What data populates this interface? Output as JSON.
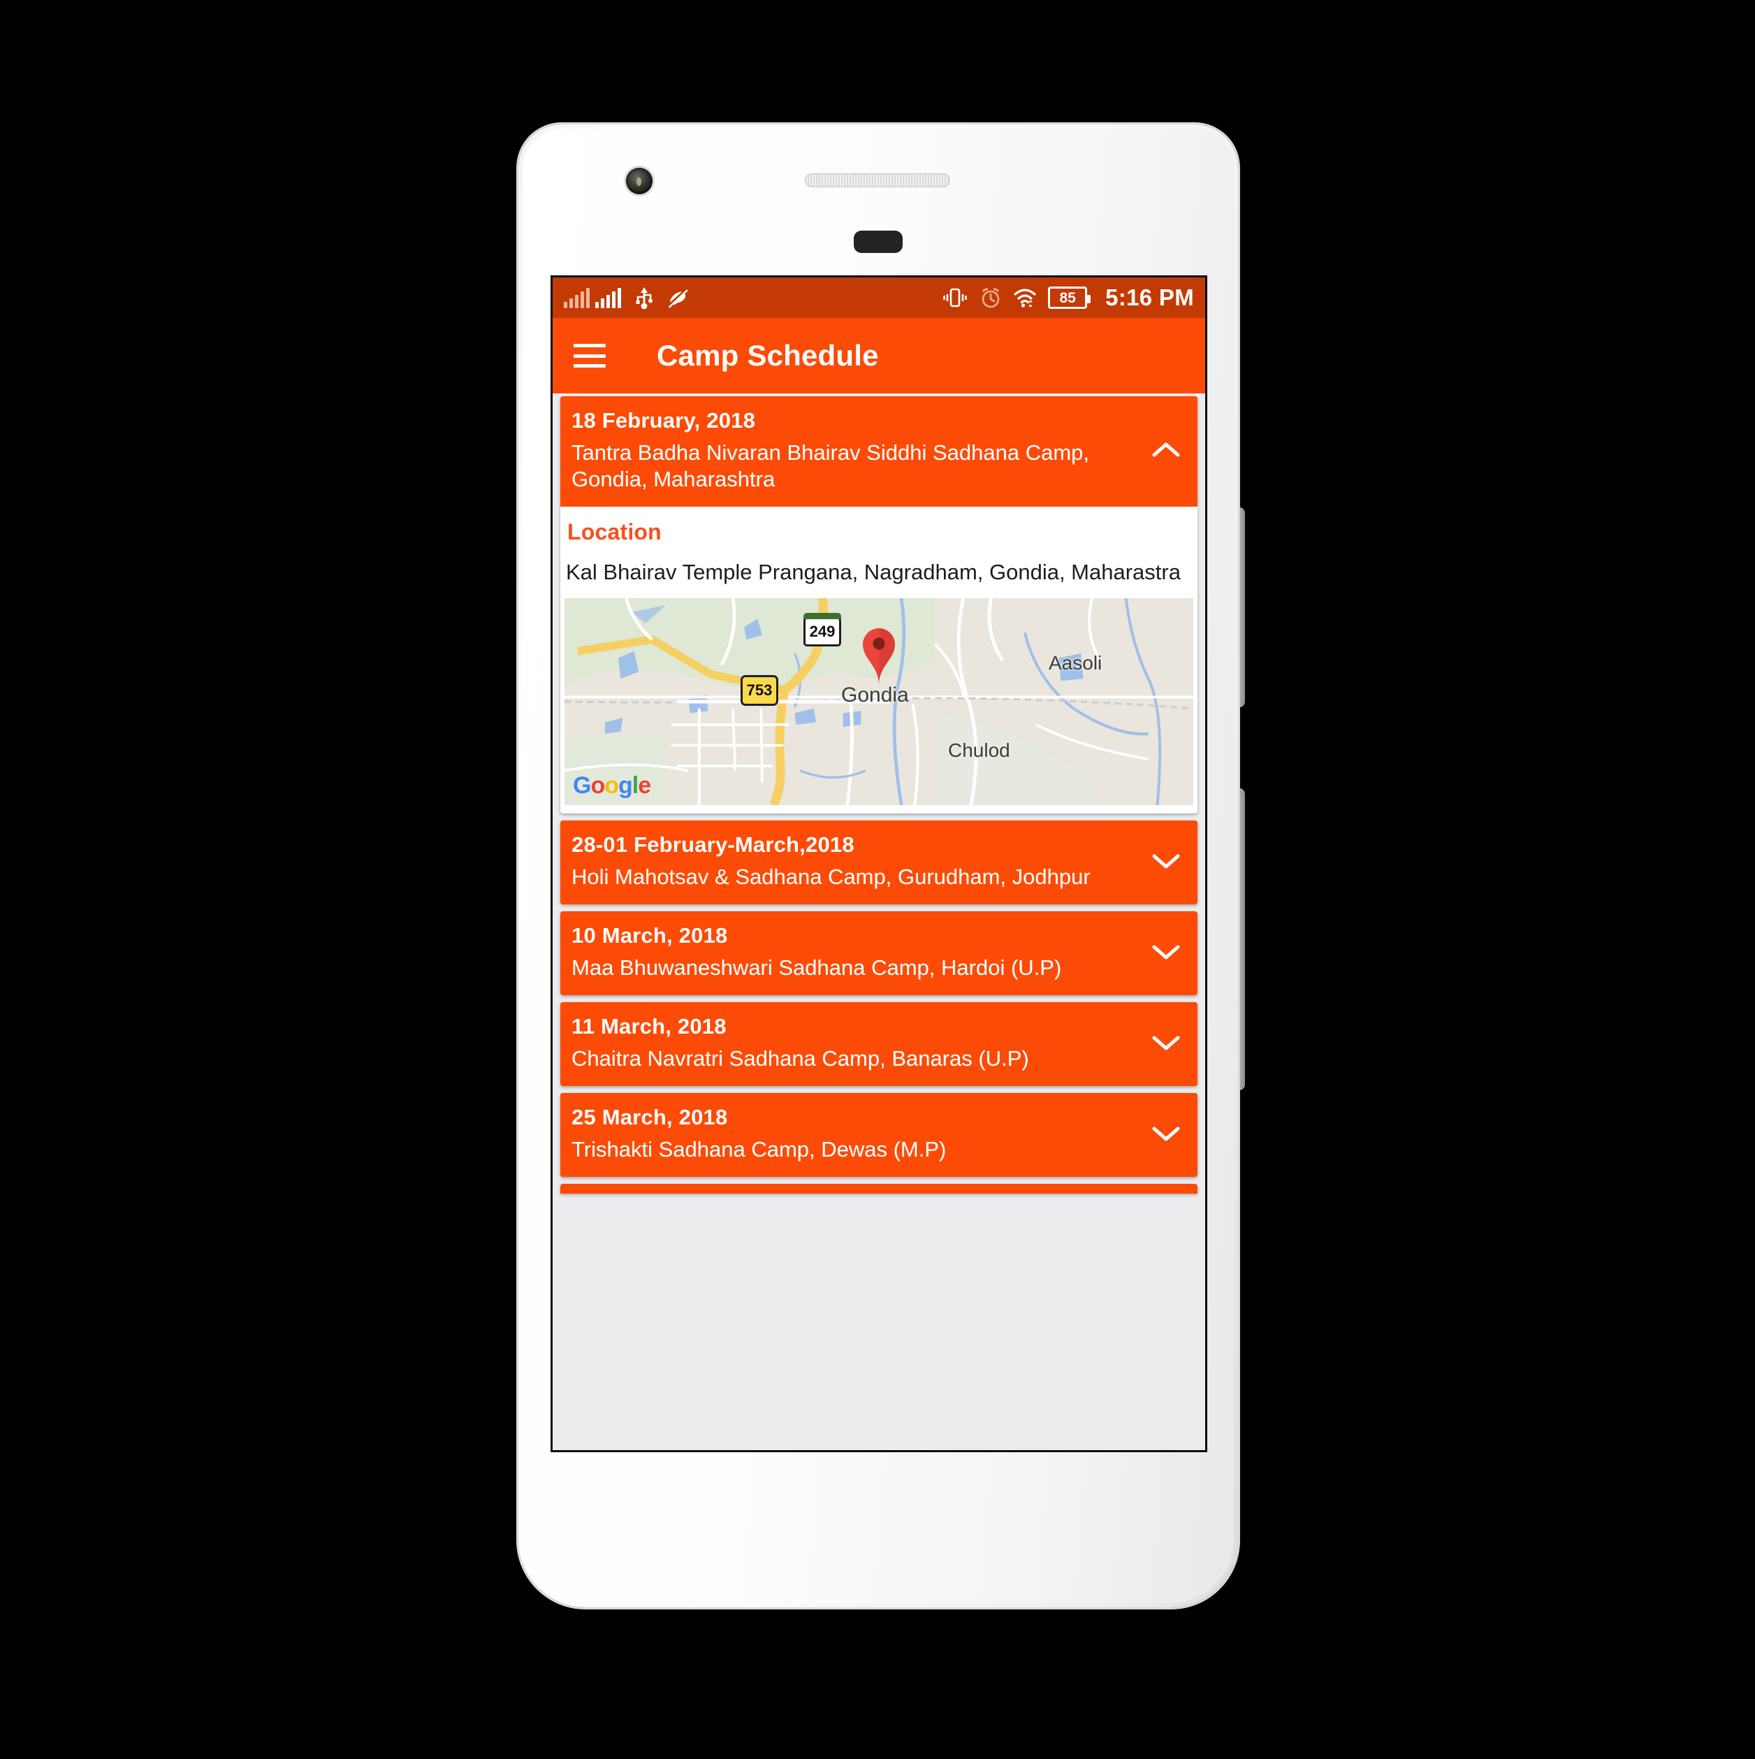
{
  "status_bar": {
    "time": "5:16 PM",
    "battery_level": "85",
    "icons": [
      "signal-bars-sim1",
      "signal-bars-sim2",
      "usb-icon",
      "mute-icon",
      "vibrate-icon",
      "alarm-icon",
      "wifi-icon",
      "battery-icon"
    ]
  },
  "app_bar": {
    "menu_icon": "hamburger-menu-icon",
    "title": "Camp Schedule"
  },
  "cards": [
    {
      "date": "18 February, 2018",
      "title": "Tantra Badha Nivaran Bhairav Siddhi Sadhana Camp, Gondia, Maharashtra",
      "expanded": true,
      "chevron": "chevron-up-icon",
      "location_label": "Location",
      "location_text": "Kal Bhairav Temple Prangana, Nagradham, Gondia, Maharastra",
      "map": {
        "attribution": "Google",
        "place_labels": [
          "Gondia",
          "Aasoli",
          "Chulod"
        ],
        "highway_shields": [
          "249",
          "753"
        ],
        "marker": "map-pin-marker"
      }
    },
    {
      "date": "28-01 February-March,2018",
      "title": "Holi Mahotsav & Sadhana Camp, Gurudham, Jodhpur",
      "expanded": false,
      "chevron": "chevron-down-icon"
    },
    {
      "date": "10 March, 2018",
      "title": "Maa Bhuwaneshwari Sadhana Camp, Hardoi (U.P)",
      "expanded": false,
      "chevron": "chevron-down-icon"
    },
    {
      "date": "11 March, 2018",
      "title": "Chaitra Navratri  Sadhana Camp, Banaras (U.P)",
      "expanded": false,
      "chevron": "chevron-down-icon"
    },
    {
      "date": "25 March, 2018",
      "title": "Trishakti Sadhana Camp,  Dewas (M.P)",
      "expanded": false,
      "chevron": "chevron-down-icon"
    }
  ],
  "colors": {
    "status_bar": "#c33a05",
    "primary_orange": "#fb4b07",
    "accent_orange": "#f8501a",
    "screen_background": "#ececee",
    "card_text": "#ffffff",
    "body_text": "#1d1d1d"
  },
  "device": {
    "elements": [
      "front-camera",
      "earpiece-speaker",
      "power-button",
      "volume-button"
    ]
  }
}
